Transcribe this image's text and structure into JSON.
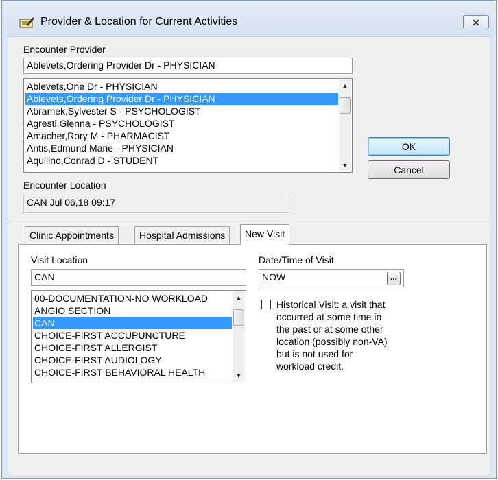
{
  "window": {
    "title": "Provider & Location for Current Activities"
  },
  "provider": {
    "label": "Encounter Provider",
    "value": "Ablevets,Ordering Provider Dr - PHYSICIAN",
    "list": [
      "Ablevets,One Dr - PHYSICIAN",
      "Ablevets,Ordering Provider Dr - PHYSICIAN",
      "Abramek,Sylvester S - PSYCHOLOGIST",
      "Agresti,Glenna - PSYCHOLOGIST",
      "Amacher,Rory M - PHARMACIST",
      "Antis,Edmund Marie - PHYSICIAN",
      "Aquilino,Conrad D - STUDENT"
    ]
  },
  "buttons": {
    "ok": "OK",
    "cancel": "Cancel"
  },
  "location": {
    "label": "Encounter Location",
    "value": "CAN  Jul 06,18 09:17"
  },
  "tabs": [
    {
      "label": "Clinic Appointments"
    },
    {
      "label": "Hospital Admissions"
    },
    {
      "label": "New Visit"
    }
  ],
  "visit": {
    "location_label": "Visit Location",
    "location_value": "CAN",
    "locations": [
      "00-DOCUMENTATION-NO WORKLOAD",
      "ANGIO SECTION",
      "CAN",
      "CHOICE-FIRST ACCUPUNCTURE",
      "CHOICE-FIRST ALLERGIST",
      "CHOICE-FIRST AUDIOLOGY",
      "CHOICE-FIRST BEHAVIORAL HEALTH"
    ],
    "datetime_label": "Date/Time of Visit",
    "datetime_value": "NOW",
    "datetime_button": "...",
    "historical": {
      "lines": [
        "Historical Visit: a visit that",
        "occurred at some time in",
        "the past or at some other",
        "location (possibly non-VA)",
        "but is not used for",
        "workload credit."
      ]
    }
  }
}
